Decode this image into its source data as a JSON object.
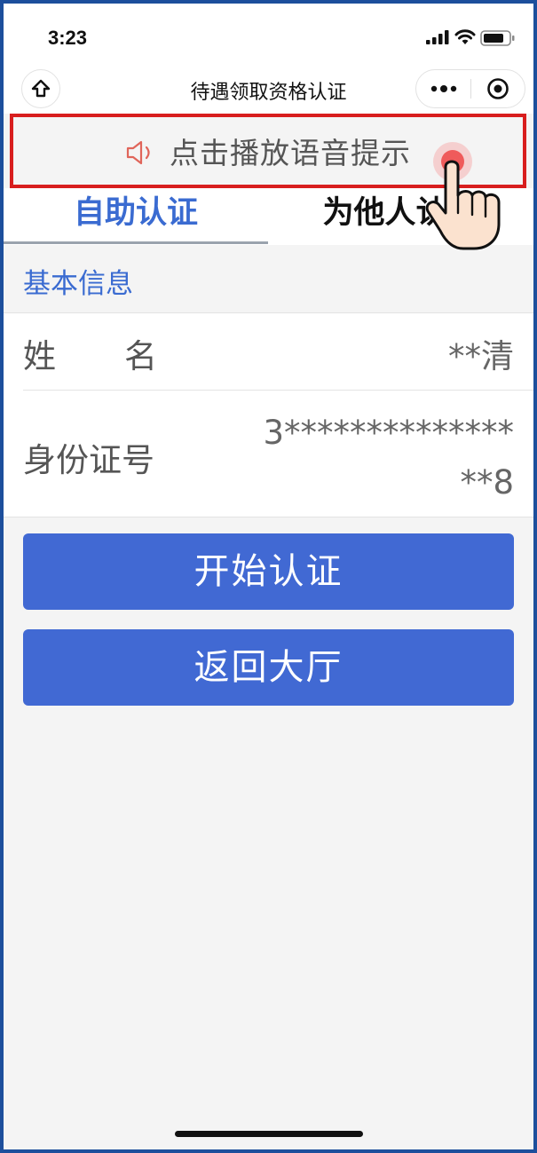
{
  "status_bar": {
    "time": "3:23"
  },
  "nav": {
    "title": "待遇领取资格认证",
    "home_icon": "home-icon",
    "more_icon": "more-dots-icon",
    "close_icon": "target-close-icon"
  },
  "voice_hint": {
    "text": "点击播放语音提示",
    "icon": "speaker-icon",
    "highlight_color": "#d81e1e"
  },
  "tabs": [
    {
      "label": "自助认证",
      "active": true
    },
    {
      "label": "为他人认证",
      "active": false
    }
  ],
  "section": {
    "title": "基本信息"
  },
  "info": {
    "name_label": "姓　　名",
    "name_value": "**清",
    "id_label": "身份证号",
    "id_value": "3****************8"
  },
  "buttons": {
    "start": "开始认证",
    "back": "返回大厅"
  },
  "colors": {
    "accent": "#4169d3",
    "frame": "#1d4f9c",
    "background": "#f4f4f4"
  }
}
